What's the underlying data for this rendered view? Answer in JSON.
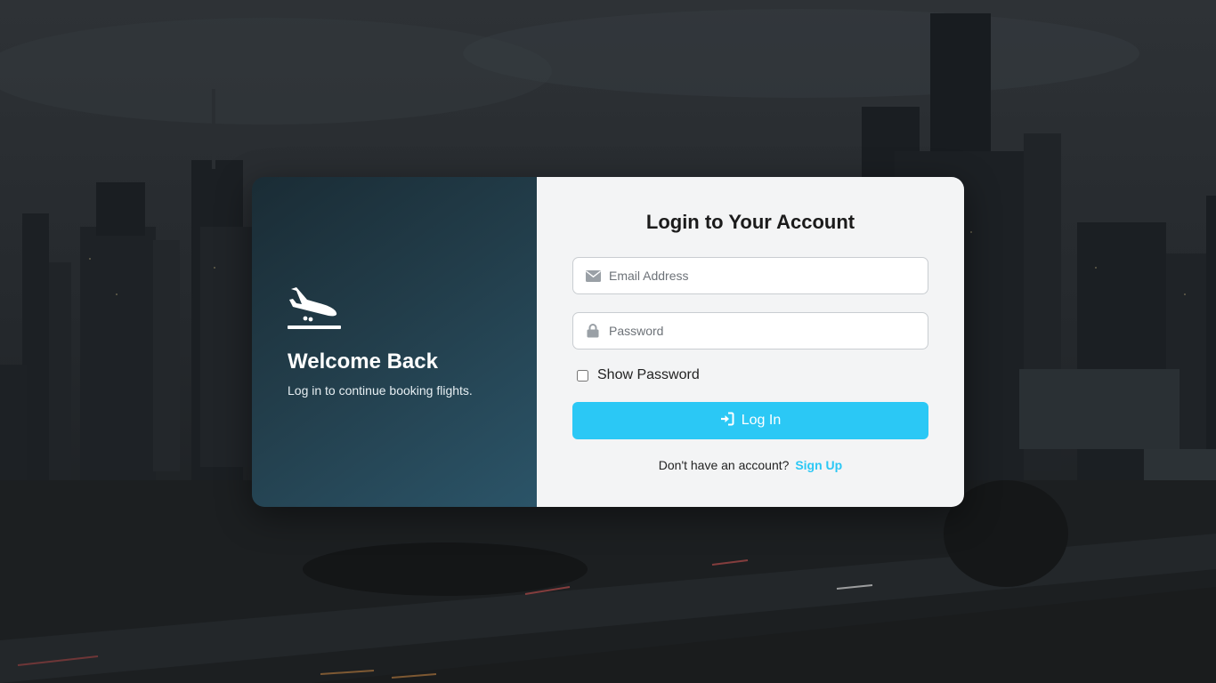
{
  "welcome": {
    "title": "Welcome Back",
    "subtitle": "Log in to continue booking flights.",
    "icon": "plane-arrival-icon"
  },
  "form": {
    "title": "Login to Your Account",
    "email": {
      "placeholder": "Email Address",
      "value": "",
      "icon": "envelope-icon"
    },
    "password": {
      "placeholder": "Password",
      "value": "",
      "icon": "lock-icon"
    },
    "show_password": {
      "label": "Show Password",
      "checked": false
    },
    "submit": {
      "label": "Log In",
      "icon": "sign-in-icon"
    },
    "signup": {
      "prompt": "Don't have an account?",
      "link_label": "Sign Up"
    }
  },
  "colors": {
    "accent": "#2bc8f5",
    "panel_dark": "#223d4a",
    "panel_light": "#f3f4f5"
  }
}
